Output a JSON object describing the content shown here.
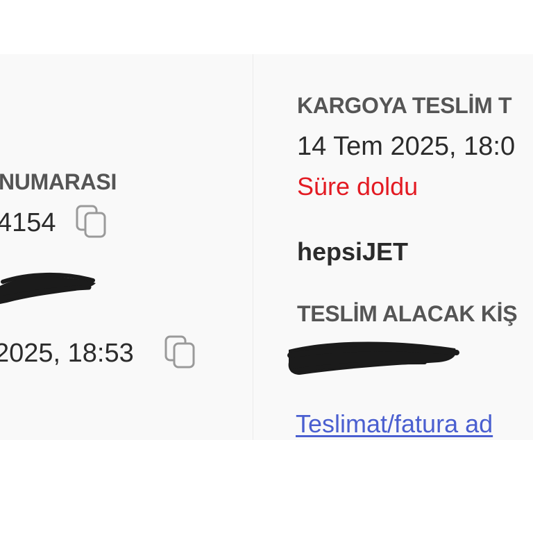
{
  "left": {
    "order_number_label": "NUMARASI",
    "order_number_value": "4154",
    "order_date_value": "2025, 18:53"
  },
  "right": {
    "cargo_label": "KARGOYA TESLİM T",
    "cargo_date": "14 Tem 2025, 18:0",
    "status": "Süre doldu",
    "carrier": "hepsiJET",
    "recipient_label": "TESLİM ALACAK KİŞ",
    "address_link": "Teslimat/fatura ad"
  },
  "icons": {
    "copy": "copy-icon"
  },
  "colors": {
    "status_red": "#e31b23",
    "link_blue": "#4a5fd0",
    "label_gray": "#555555",
    "card_bg": "#f9f9f9"
  }
}
